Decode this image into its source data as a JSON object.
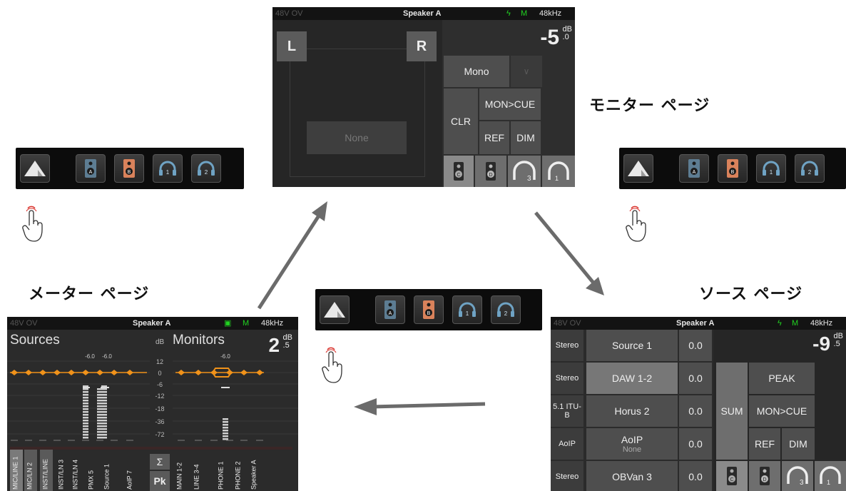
{
  "headings": {
    "monitor_page": "モニター ページ",
    "meter_page": "メーター ページ",
    "source_page": "ソース ページ"
  },
  "strip_buttons": [
    "triangle-icon",
    "speaker-a-icon",
    "speaker-b-icon",
    "headphone-1-icon",
    "headphone-2-icon"
  ],
  "status": {
    "faint": "48V OV",
    "speaker": "Speaker A",
    "mode": "M",
    "rate": "48kHz"
  },
  "monitor_screen": {
    "left": "L",
    "right": "R",
    "none": "None",
    "level_main": "-5",
    "level_unit": "dB",
    "level_frac": ".0",
    "mono": "Mono",
    "mono_arrow": "∨",
    "clr": "CLR",
    "mon_cue": "MON>CUE",
    "ref": "REF",
    "dim": "DIM",
    "spk_c": "C",
    "spk_d": "D",
    "hp_3": "3",
    "hp_1": "1"
  },
  "meter_screen": {
    "sources_title": "Sources",
    "monitors_title": "Monitors",
    "db_label": "dB",
    "level_main": "2",
    "level_unit": "dB",
    "level_frac": ".5",
    "scale": [
      "12",
      "0",
      "-6",
      "-12",
      "-18",
      "-36",
      "-72"
    ],
    "source_peaks": [
      "-6.0",
      "-6.0"
    ],
    "monitor_peak": "-6.0",
    "sigma": "Σ",
    "pk": "Pk",
    "source_channels": [
      "MIC/LINE 1",
      "MIC/LN 2",
      "INST/LINE",
      "INST/LN 3",
      "INST/LN 4",
      "PMX 5",
      "Source 1",
      "AoIP 7"
    ],
    "monitor_channels": [
      "MAIN 1-2",
      "LINE 3-4",
      "PHONE 1",
      "PHONE 2",
      "Speaker A"
    ]
  },
  "source_screen": {
    "level_main": "-9",
    "level_unit": "dB",
    "level_frac": ".5",
    "rows": [
      {
        "format": "Stereo",
        "name": "Source 1",
        "sub": "",
        "value": "0.0"
      },
      {
        "format": "Stereo",
        "name": "DAW 1-2",
        "sub": "",
        "value": "0.0"
      },
      {
        "format": "5.1 ITU-B",
        "name": "Horus 2",
        "sub": "",
        "value": "0.0"
      },
      {
        "format": "AoIP",
        "name": "AoIP",
        "sub": "None",
        "value": "0.0"
      },
      {
        "format": "Stereo",
        "name": "OBVan 3",
        "sub": "",
        "value": "0.0"
      }
    ],
    "sum": "SUM",
    "peak": "PEAK",
    "mon_cue": "MON>CUE",
    "ref": "REF",
    "dim": "DIM",
    "spk_c": "C",
    "spk_d": "D",
    "hp_3": "3",
    "hp_1": "1"
  },
  "colors": {
    "speaker_a": "#5d7d93",
    "speaker_b": "#d9825b",
    "meter_orange": "#f0921a",
    "status_green": "#21d321"
  }
}
